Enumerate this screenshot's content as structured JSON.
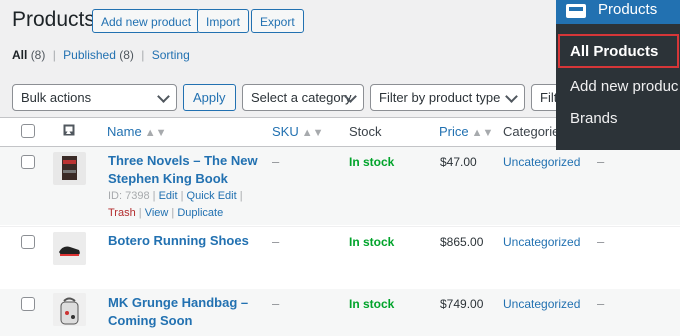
{
  "page": {
    "title": "Products",
    "buttons": {
      "add_new": "Add new product",
      "import": "Import",
      "export": "Export"
    }
  },
  "views": {
    "all_label": "All",
    "all_count": "(8)",
    "published_label": "Published",
    "published_count": "(8)",
    "sorting_label": "Sorting",
    "separator": "|"
  },
  "filters": {
    "bulk_actions": "Bulk actions",
    "apply": "Apply",
    "category": "Select a category",
    "product_type": "Filter by product type",
    "stock_status_partial": "Filte"
  },
  "table": {
    "columns": {
      "name": "Name",
      "sku": "SKU",
      "stock": "Stock",
      "price": "Price",
      "categories": "Categories"
    },
    "rows": [
      {
        "name_line1": "Three Novels – The New",
        "name_line2": "Stephen King Book",
        "sku": "–",
        "stock": "In stock",
        "price": "$47.00",
        "category": "Uncategorized",
        "tags": "–",
        "row_actions": {
          "id": "ID: 7398",
          "edit": "Edit",
          "quick_edit": "Quick Edit",
          "trash": "Trash",
          "view": "View",
          "duplicate": "Duplicate",
          "sep": "|"
        }
      },
      {
        "name_line1": "Botero Running Shoes",
        "sku": "–",
        "stock": "In stock",
        "price": "$865.00",
        "category": "Uncategorized",
        "tags": "–"
      },
      {
        "name_line1": "MK Grunge Handbag –",
        "name_line2": "Coming Soon",
        "sku": "–",
        "stock": "In stock",
        "price": "$749.00",
        "category": "Uncategorized",
        "tags": "–"
      }
    ]
  },
  "admin_menu": {
    "parent": "Products",
    "items": [
      "All Products",
      "Add new produc",
      "Brands"
    ],
    "active_index": 0,
    "highlight_color": "#d63638"
  },
  "colors": {
    "link": "#2271b1",
    "in_stock": "#00a32a",
    "trash": "#b32d2e",
    "menu_bg": "#2c3338"
  }
}
